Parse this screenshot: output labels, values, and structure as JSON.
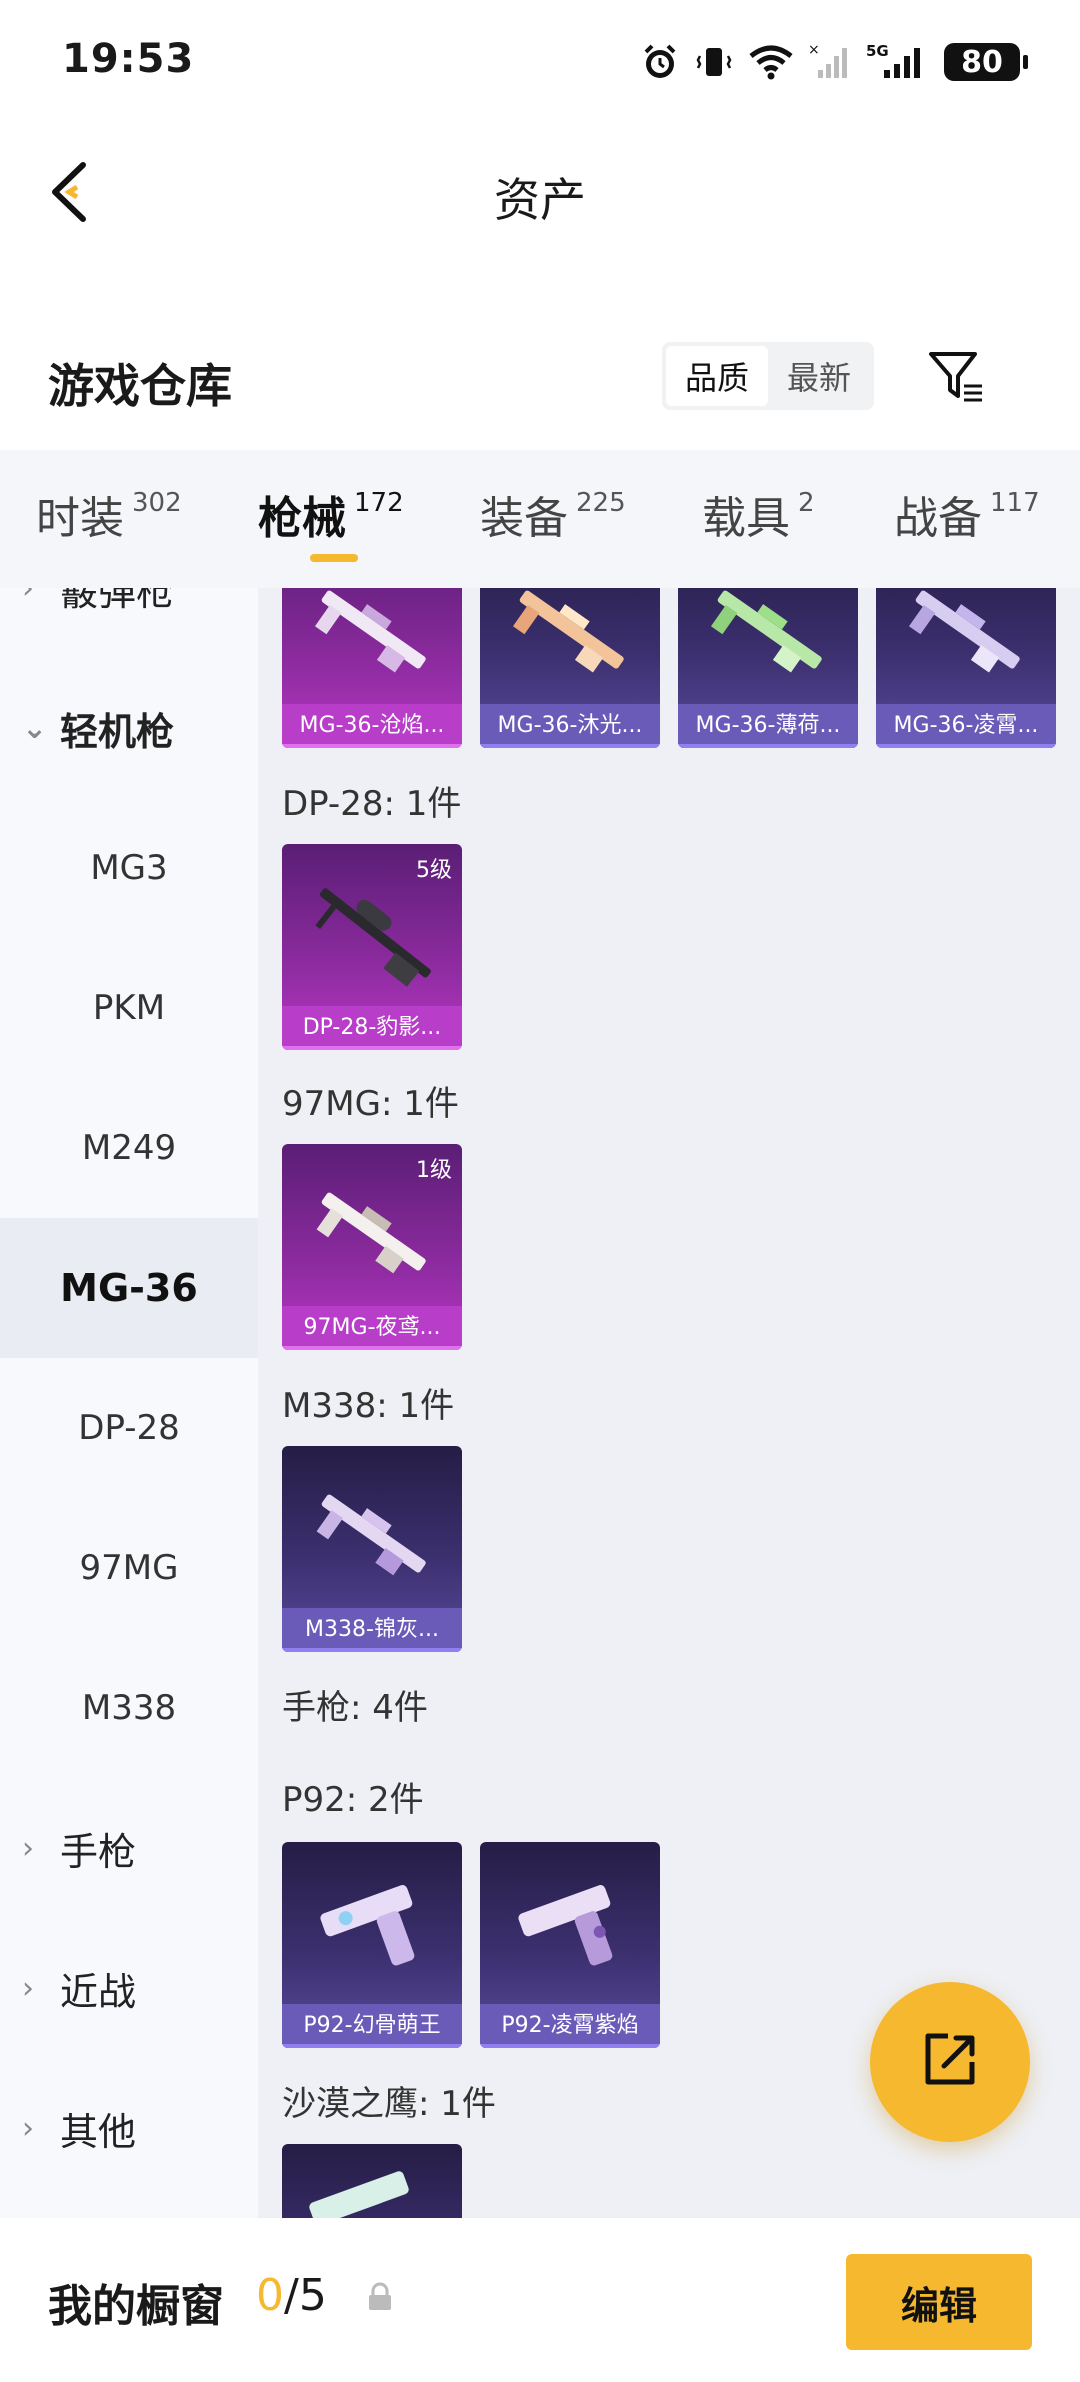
{
  "status_bar": {
    "time": "19:53",
    "network": "5G",
    "battery": "80"
  },
  "nav": {
    "title": "资产",
    "back_icon": "chevron-left-icon"
  },
  "section": {
    "title": "游戏仓库",
    "sort_options": [
      "品质",
      "最新"
    ],
    "sort_active": "品质",
    "filter_icon": "filter-icon"
  },
  "tabs": [
    {
      "label": "时装",
      "count": "302"
    },
    {
      "label": "枪械",
      "count": "172",
      "active": true
    },
    {
      "label": "装备",
      "count": "225"
    },
    {
      "label": "载具",
      "count": "2"
    },
    {
      "label": "战备",
      "count": "117"
    }
  ],
  "sidebar": {
    "groups_top": [
      {
        "label": "霰弹枪",
        "state": "collapsed"
      },
      {
        "label": "轻机枪",
        "state": "expanded"
      }
    ],
    "sub_items": [
      "MG3",
      "PKM",
      "M249",
      "MG-36",
      "DP-28",
      "97MG",
      "M338"
    ],
    "active_sub_item": "MG-36",
    "groups_bottom": [
      {
        "label": "手枪",
        "state": "collapsed"
      },
      {
        "label": "近战",
        "state": "collapsed"
      },
      {
        "label": "其他",
        "state": "collapsed"
      }
    ]
  },
  "content": {
    "mg36_items": [
      "MG-36-沧焰...",
      "MG-36-沐光...",
      "MG-36-薄荷...",
      "MG-36-凌霄..."
    ],
    "dp28": {
      "label": "DP-28: 1件",
      "items": [
        {
          "name": "DP-28-豹影...",
          "level": "5级"
        }
      ]
    },
    "mg97": {
      "label": "97MG: 1件",
      "items": [
        {
          "name": "97MG-夜鸢...",
          "level": "1级"
        }
      ]
    },
    "m338": {
      "label": "M338: 1件",
      "items": [
        {
          "name": "M338-锦灰..."
        }
      ]
    },
    "pistol_header": "手枪: 4件",
    "p92": {
      "label": "P92: 2件",
      "items": [
        {
          "name": "P92-幻骨萌王"
        },
        {
          "name": "P92-凌霄紫焰"
        }
      ]
    },
    "deagle": {
      "label": "沙漠之鹰: 1件"
    }
  },
  "fab": {
    "icon": "share-export-icon"
  },
  "bottom_bar": {
    "label": "我的橱窗",
    "count_current": "0",
    "count_sep_total": "/5",
    "lock_icon": "lock-icon",
    "edit_label": "编辑"
  },
  "colors": {
    "accent": "#f5b82e",
    "card_purple": "#8a2a9d",
    "card_blue": "#3c3070",
    "content_bg": "#eef0f5",
    "sidebar_bg": "#f7f9fc"
  }
}
